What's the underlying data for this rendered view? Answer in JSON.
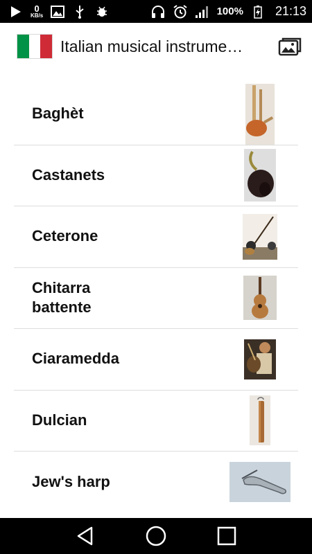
{
  "status_bar": {
    "net_speed_value": "0",
    "net_speed_unit": "KB/s",
    "battery_percent": "100%",
    "time": "21:13",
    "icons": [
      "play-icon",
      "image-icon",
      "usb-icon",
      "bug-icon",
      "headphones-icon",
      "alarm-icon",
      "signal-icon",
      "battery-charging-icon"
    ]
  },
  "app_bar": {
    "title": "Italian musical instrume…",
    "flag": {
      "green": "#009246",
      "white": "#ffffff",
      "red": "#ce2b37"
    },
    "action_icon": "gallery-icon"
  },
  "instruments": [
    {
      "name": "Baghèt",
      "thumb": "bagpipe-photo"
    },
    {
      "name": "Castanets",
      "thumb": "castanets-photo"
    },
    {
      "name": "Ceterone",
      "thumb": "ceterone-photo"
    },
    {
      "name": "Chitarra battente",
      "thumb": "guitar-photo"
    },
    {
      "name": "Ciaramedda",
      "thumb": "ciaramedda-photo"
    },
    {
      "name": "Dulcian",
      "thumb": "dulcian-photo"
    },
    {
      "name": "Jew's harp",
      "thumb": "jews-harp-photo"
    }
  ],
  "nav_bar": {
    "icons": [
      "back-icon",
      "home-icon",
      "recents-icon"
    ]
  }
}
